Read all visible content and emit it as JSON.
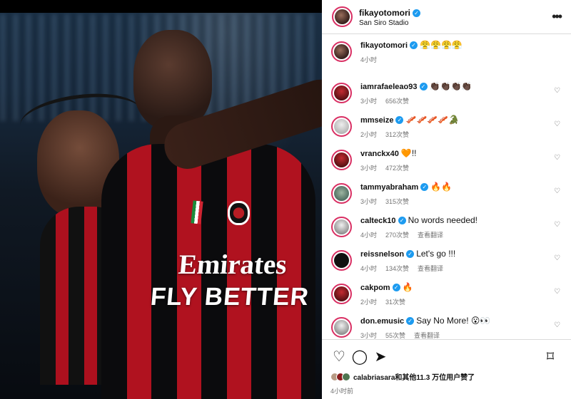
{
  "post": {
    "username": "fikayotomori",
    "location": "San Siro Stadio",
    "caption": "😤😤😤😤",
    "caption_time": "4小时",
    "photo": {
      "sponsor_name": "Emirates",
      "sponsor_line": "FLY BETTER"
    }
  },
  "icons": {
    "verified": "✓",
    "more": "•••",
    "heart": "♡",
    "comment": "◯",
    "share": "➤",
    "save": "⌑"
  },
  "comments": [
    {
      "user": "iamrafaeleao93",
      "text": "👏🏿👏🏿👏🏿👏🏿",
      "time": "3小时",
      "likes": "656次赞",
      "translate": "",
      "verified": true,
      "avatar": "red"
    },
    {
      "user": "mmseize",
      "text": "🥓🥓🥓🥓🐊",
      "time": "2小时",
      "likes": "312次赞",
      "translate": "",
      "verified": true,
      "avatar": "white"
    },
    {
      "user": "vranckx40",
      "text": "🧡!!",
      "time": "3小时",
      "likes": "472次赞",
      "translate": "",
      "verified": false,
      "avatar": "red"
    },
    {
      "user": "tammyabraham",
      "text": "🔥🔥",
      "time": "3小时",
      "likes": "315次赞",
      "translate": "",
      "verified": true,
      "avatar": "green"
    },
    {
      "user": "calteck10",
      "text": "No words needed!",
      "time": "4小时",
      "likes": "270次赞",
      "translate": "查看翻译",
      "verified": true,
      "avatar": "gray"
    },
    {
      "user": "reissnelson",
      "text": "Let's go !!!",
      "time": "4小时",
      "likes": "134次赞",
      "translate": "查看翻译",
      "verified": true,
      "avatar": "dark"
    },
    {
      "user": "cakpom",
      "text": "🔥",
      "time": "2小时",
      "likes": "31次赞",
      "translate": "",
      "verified": true,
      "avatar": "red"
    },
    {
      "user": "don.emusic",
      "text": "Say No More! 😮👀",
      "time": "3小时",
      "likes": "55次赞",
      "translate": "查看翻译",
      "verified": true,
      "avatar": "gray"
    }
  ],
  "footer": {
    "likes_text": "calabriasara和其他11.3 万位用户赞了",
    "post_time": "4小时前"
  }
}
